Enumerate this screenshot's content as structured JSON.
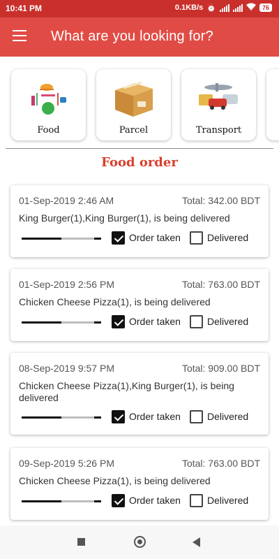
{
  "status_bar": {
    "time": "10:41 PM",
    "net_speed": "0.1KB/s",
    "battery": "76"
  },
  "app_bar": {
    "title": "What are you looking for?",
    "menu_icon": "hamburger-menu-icon"
  },
  "categories": [
    {
      "label": "Food",
      "icon": "food-icon"
    },
    {
      "label": "Parcel",
      "icon": "parcel-box-icon"
    },
    {
      "label": "Transport",
      "icon": "transport-vehicles-icon"
    }
  ],
  "section_title": "Food order",
  "orders": [
    {
      "date": "01-Sep-2019 2:46 AM",
      "total": "Total: 342.00 BDT",
      "items": "King Burger(1),King Burger(1), is being delivered",
      "progress": 0.5,
      "order_taken_label": "Order taken",
      "order_taken": true,
      "delivered_label": "Delivered",
      "delivered": false
    },
    {
      "date": "01-Sep-2019 2:56 PM",
      "total": "Total: 763.00 BDT",
      "items": "Chicken Cheese Pizza(1), is being delivered",
      "progress": 0.5,
      "order_taken_label": "Order taken",
      "order_taken": true,
      "delivered_label": "Delivered",
      "delivered": false
    },
    {
      "date": "08-Sep-2019 9:57 PM",
      "total": "Total: 909.00 BDT",
      "items": "Chicken Cheese Pizza(1),King Burger(1), is being delivered",
      "progress": 0.5,
      "order_taken_label": "Order taken",
      "order_taken": true,
      "delivered_label": "Delivered",
      "delivered": false
    },
    {
      "date": "09-Sep-2019 5:26 PM",
      "total": "Total: 763.00 BDT",
      "items": "Chicken Cheese Pizza(1), is being delivered",
      "progress": 0.5,
      "order_taken_label": "Order taken",
      "order_taken": true,
      "delivered_label": "Delivered",
      "delivered": false
    }
  ],
  "colors": {
    "status_bar": "#c9302c",
    "app_bar": "#e04c45",
    "section_title": "#d8412f"
  }
}
